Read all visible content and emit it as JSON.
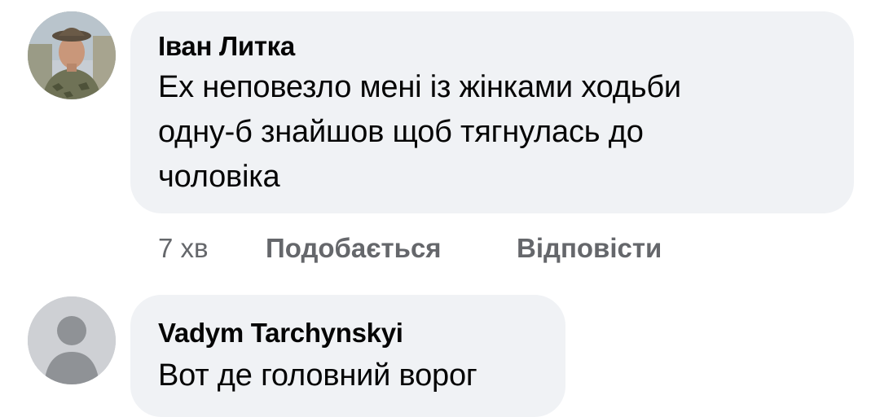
{
  "comments": [
    {
      "author": "Іван Литка",
      "text": "Ех неповезло мені із жінками ходьби\nодну-б  знайшов щоб тягнулась до\nчоловіка",
      "time": "7 хв",
      "like_label": "Подобається",
      "reply_label": "Відповісти"
    },
    {
      "author": "Vadym Tarchynskyi",
      "text": "Вот де головний ворог"
    }
  ]
}
